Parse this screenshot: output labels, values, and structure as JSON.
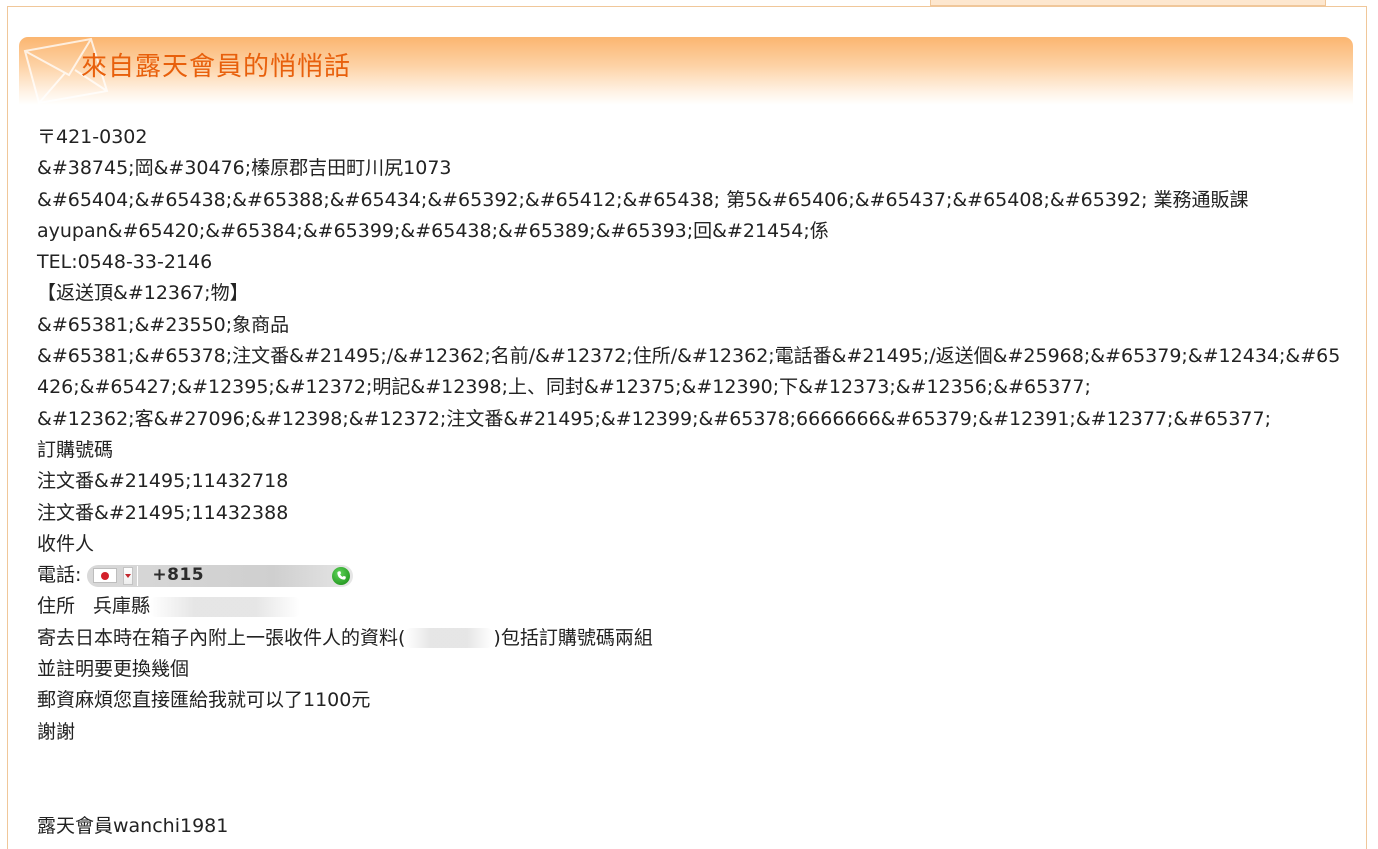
{
  "header": {
    "title": "來自露天會員的悄悄話"
  },
  "message": {
    "lines": [
      "〒421-0302",
      "&#38745;岡&#30476;榛原郡吉田町川尻1073",
      "&#65404;&#65438;&#65388;&#65434;&#65392;&#65412;&#65438; 第5&#65406;&#65437;&#65408;&#65392; 業務通販課",
      "ayupan&#65420;&#65384;&#65399;&#65438;&#65389;&#65393;回&#21454;係",
      "TEL:0548-33-2146",
      "【返送頂&#12367;物】",
      "&#65381;&#23550;象商品",
      "&#65381;&#65378;注文番&#21495;/&#12362;名前/&#12372;住所/&#12362;電話番&#21495;/返送個&#25968;&#65379;&#12434;&#65",
      "426;&#65427;&#12395;&#12372;明記&#12398;上、同封&#12375;&#12390;下&#12373;&#12356;&#65377;",
      "&#12362;客&#27096;&#12398;&#12372;注文番&#21495;&#12399;&#65378;6666666&#65379;&#12391;&#12377;&#65377;",
      "訂購號碼",
      "注文番&#21495;11432718",
      "注文番&#21495;11432388",
      "收件人"
    ],
    "phone_label": "電話:",
    "phone_number": "+815",
    "address_label": "住所",
    "address_value": "兵庫縣",
    "note_before": "寄去日本時在箱子內附上一張收件人的資料(",
    "note_after": ")包括訂購號碼兩組",
    "line_exchange": "並註明要更換幾個",
    "line_postage": "郵資麻煩您直接匯給我就可以了1100元",
    "line_thanks": "謝謝",
    "signature": "露天會員wanchi1981"
  },
  "icons": {
    "envelope": "envelope-icon",
    "flag": "japan-flag-icon",
    "call": "phone-call-icon"
  },
  "colors": {
    "title": "#e8600c",
    "header_gradient_top": "#fbb570",
    "frame_border": "#f0c79a",
    "text": "#222222"
  }
}
